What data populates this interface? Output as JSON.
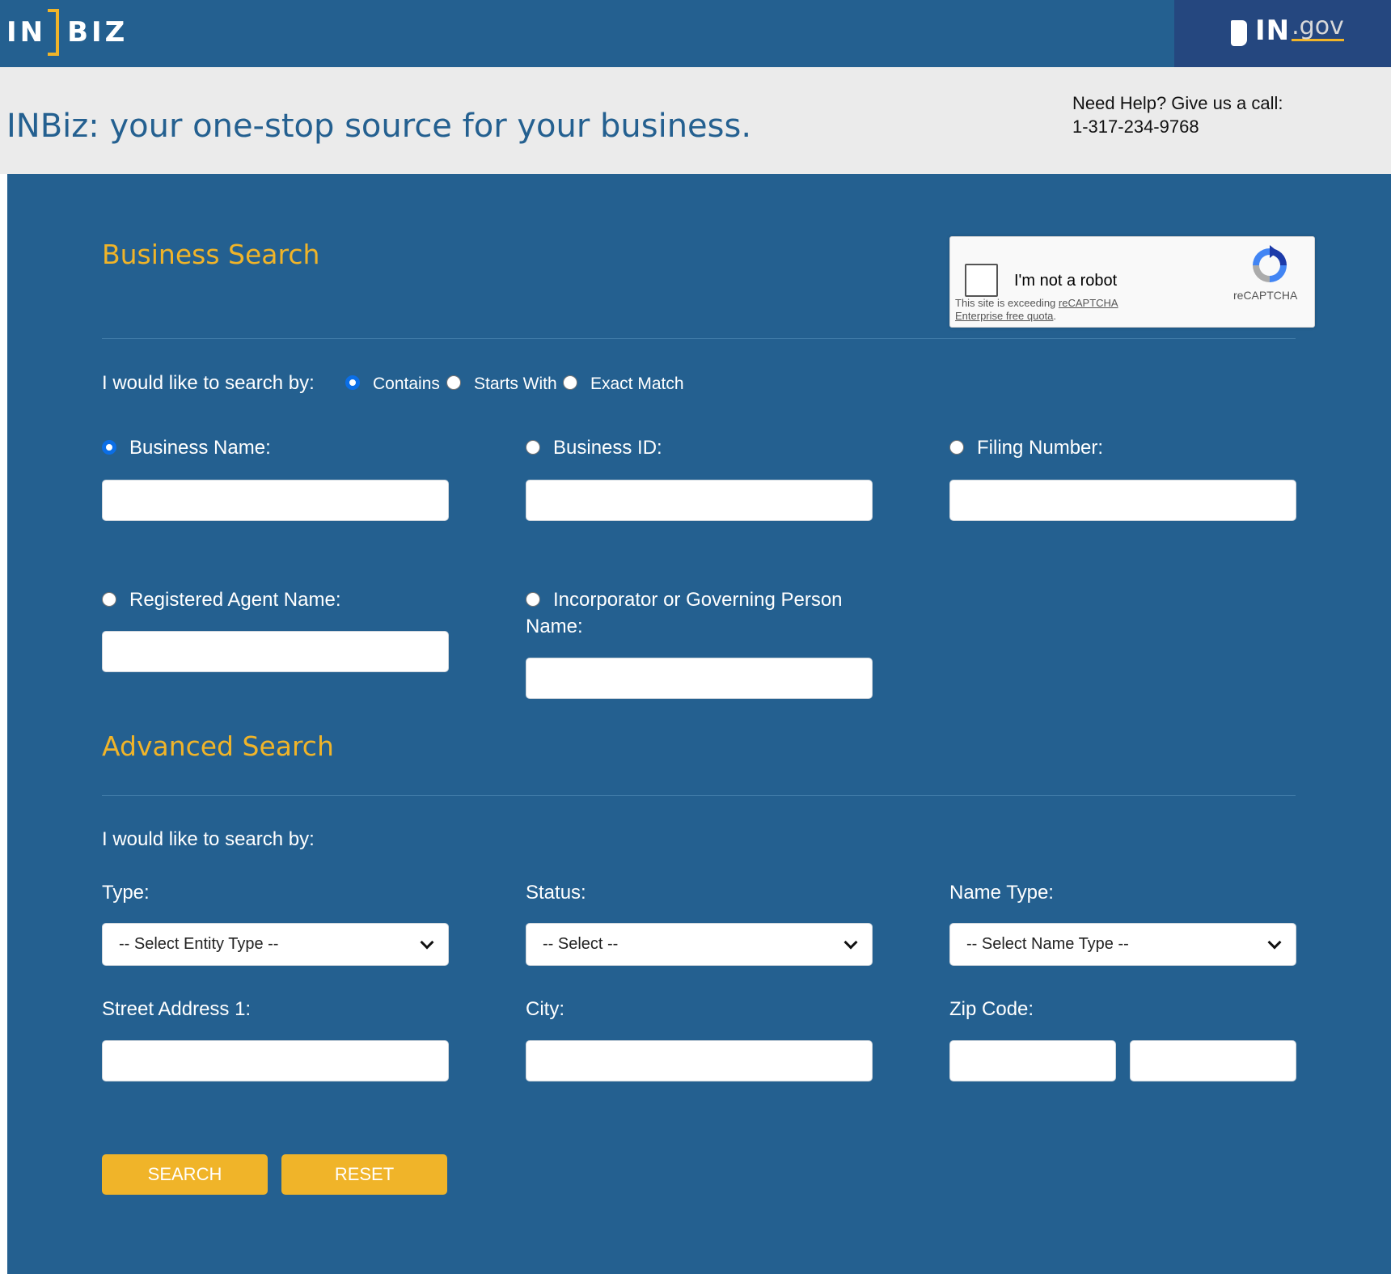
{
  "header": {
    "logo_left_a": "IN",
    "logo_left_b": "BIZ",
    "logo_right_in": "IN",
    "logo_right_gov": ".gov"
  },
  "band": {
    "tagline": "INBiz: your one-stop source for your business.",
    "help_line1": "Need Help? Give us a call:",
    "help_line2": "1-317-234-9768"
  },
  "recaptcha": {
    "label": "I'm not a robot",
    "warning_prefix": "This site is exceeding ",
    "warning_link": "reCAPTCHA Enterprise free quota",
    "warning_suffix": ".",
    "brand": "reCAPTCHA"
  },
  "business_search": {
    "title": "Business Search",
    "search_by_label": "I would like to search by:",
    "match_options": [
      {
        "label": "Contains",
        "selected": true
      },
      {
        "label": "Starts With",
        "selected": false
      },
      {
        "label": "Exact Match",
        "selected": false
      }
    ],
    "fields": [
      {
        "label": "Business Name:",
        "selected": true,
        "value": ""
      },
      {
        "label": "Business ID:",
        "selected": false,
        "value": ""
      },
      {
        "label": "Filing Number:",
        "selected": false,
        "value": ""
      },
      {
        "label": "Registered Agent Name:",
        "selected": false,
        "value": ""
      },
      {
        "label": "Incorporator or Governing Person",
        "label_line2": "Name:",
        "selected": false,
        "value": ""
      }
    ]
  },
  "advanced_search": {
    "title": "Advanced Search",
    "search_by_label": "I would like to search by:",
    "type_label": "Type:",
    "type_value": "-- Select Entity Type --",
    "status_label": "Status:",
    "status_value": "-- Select --",
    "name_type_label": "Name Type:",
    "name_type_value": "-- Select Name Type --",
    "street_label": "Street Address 1:",
    "city_label": "City:",
    "zip_label": "Zip Code:"
  },
  "buttons": {
    "search": "SEARCH",
    "reset": "RESET"
  },
  "colors": {
    "primary_blue": "#246090",
    "dark_blue": "#25477f",
    "accent_gold": "#f0b429",
    "band_gray": "#ebebeb"
  }
}
